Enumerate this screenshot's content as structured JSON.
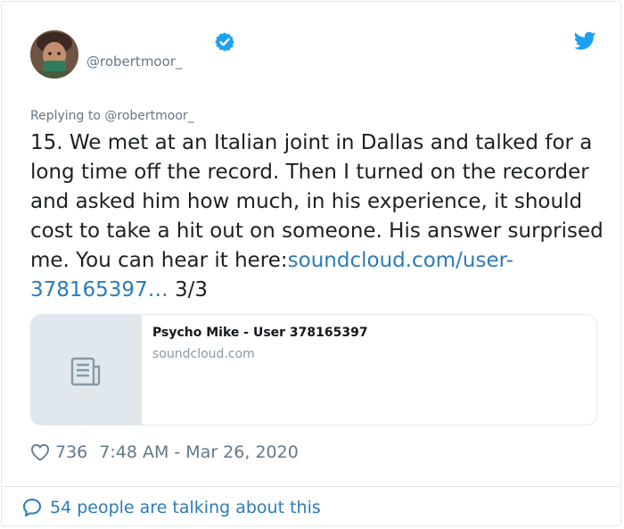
{
  "user": {
    "handle": "@robertmoor_",
    "verified": true
  },
  "tweet": {
    "replying_to": "Replying to @robertmoor_",
    "text_main": "15. We met at an Italian joint in Dallas and talked for a long time off the record. Then I turned on the recorder and asked him how much, in his experience, it should cost to take a hit out on someone. His answer surprised me. You can hear it here:",
    "link_text": "soundcloud.com/user-378165397…",
    "text_suffix": " 3/3"
  },
  "link_card": {
    "title": "Psycho Mike - User 378165397",
    "domain": "soundcloud.com"
  },
  "meta": {
    "likes": "736",
    "timestamp": "7:48 AM - Mar 26, 2020"
  },
  "footer": {
    "talking": "54 people are talking about this"
  },
  "colors": {
    "link": "#2b7bb9",
    "muted": "#657786",
    "verified": "#1da1f2"
  },
  "icons": [
    "verified-icon",
    "twitter-bird-icon",
    "article-icon",
    "heart-icon",
    "speech-bubble-icon"
  ]
}
